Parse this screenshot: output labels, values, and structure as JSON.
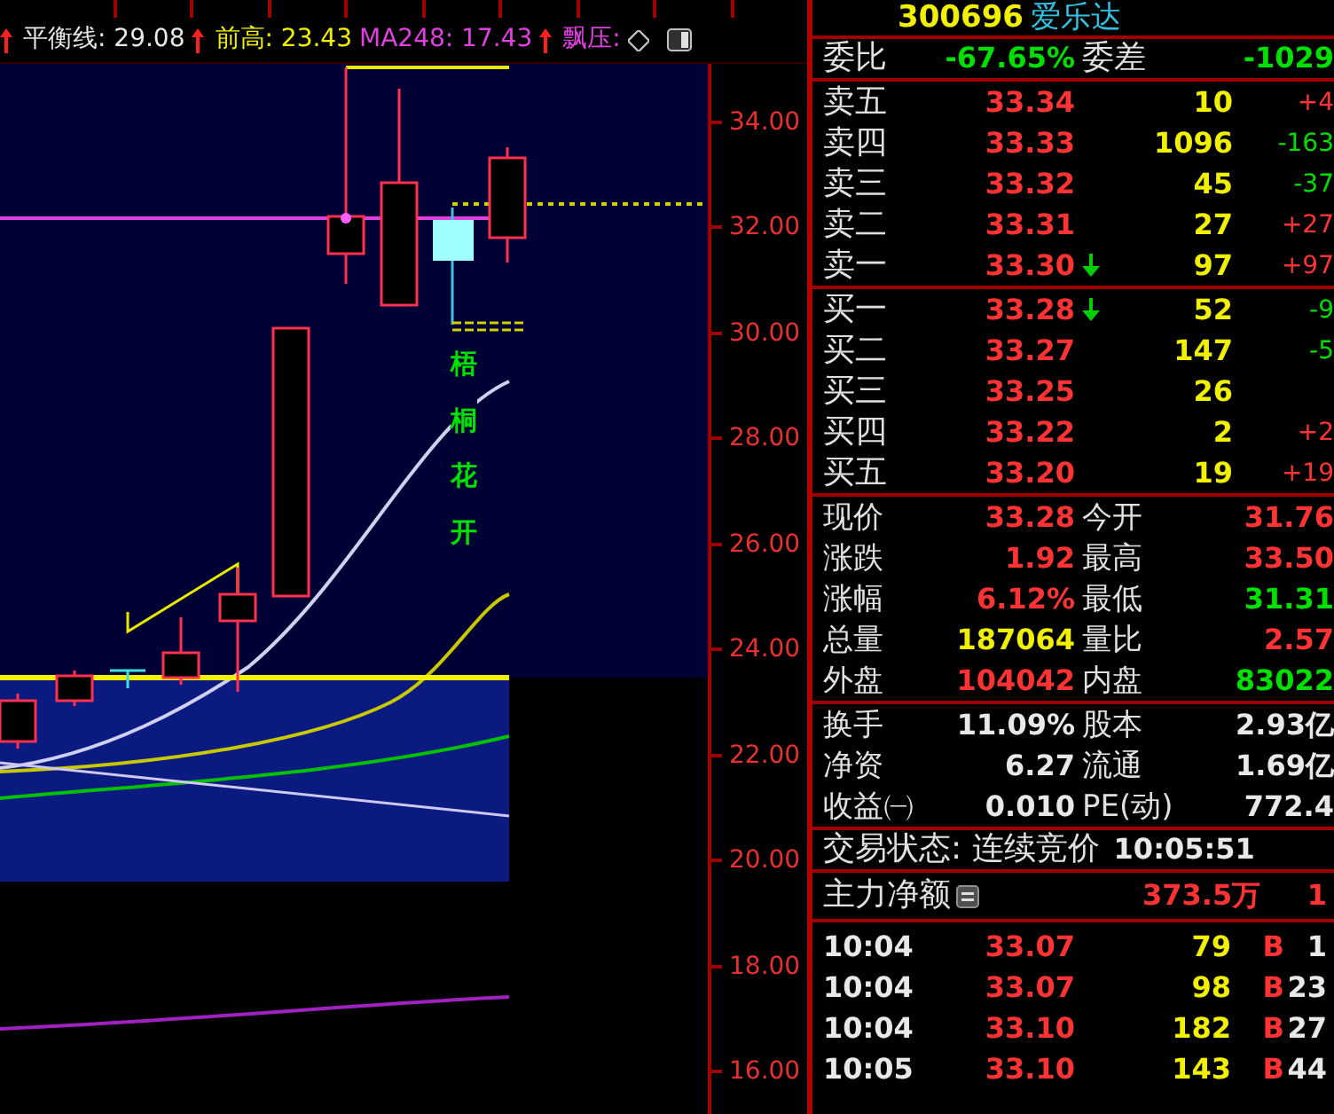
{
  "indicators": [
    {
      "label": "平衡线: 29.08",
      "color": "#e8e8e8",
      "arrow_before": true
    },
    {
      "label": "前高: 23.43",
      "color": "#f0f000",
      "arrow_before": true
    },
    {
      "label": "MA248: 17.43",
      "color": "#e040e0",
      "arrow_before": false
    },
    {
      "label": "飘压:",
      "color": "#e040e0",
      "arrow_before": true
    }
  ],
  "chart": {
    "y_axis": [
      "34.00",
      "32.00",
      "30.00",
      "28.00",
      "26.00",
      "24.00",
      "22.00",
      "20.00",
      "18.00",
      "16.00"
    ],
    "annotation": "梧桐花开"
  },
  "quote": {
    "code": "300696",
    "name": "爱乐达"
  },
  "ratio": [
    {
      "label": "委比",
      "value": "-67.65%",
      "color": "#00e000"
    },
    {
      "label": "委差",
      "value": "-1029",
      "color": "#00e000"
    }
  ],
  "asks": [
    {
      "label": "卖五",
      "price": "33.34",
      "volume": "10",
      "change": "+4",
      "color": "#ff3333",
      "arrow": false
    },
    {
      "label": "卖四",
      "price": "33.33",
      "volume": "1096",
      "change": "-163",
      "color": "#00e000",
      "arrow": false
    },
    {
      "label": "卖三",
      "price": "33.32",
      "volume": "45",
      "change": "-37",
      "color": "#00e000",
      "arrow": false
    },
    {
      "label": "卖二",
      "price": "33.31",
      "volume": "27",
      "change": "+27",
      "color": "#ff3333",
      "arrow": false
    },
    {
      "label": "卖一",
      "price": "33.30",
      "volume": "97",
      "change": "+97",
      "color": "#ff3333",
      "arrow": true
    }
  ],
  "bids": [
    {
      "label": "买一",
      "price": "33.28",
      "volume": "52",
      "change": "-9",
      "color": "#00e000",
      "arrow": true
    },
    {
      "label": "买二",
      "price": "33.27",
      "volume": "147",
      "change": "-5",
      "color": "#00e000",
      "arrow": false
    },
    {
      "label": "买三",
      "price": "33.25",
      "volume": "26",
      "arrow": false
    },
    {
      "label": "买四",
      "price": "33.22",
      "volume": "2",
      "change": "+2",
      "color": "#ff3333",
      "arrow": false
    },
    {
      "label": "买五",
      "price": "33.20",
      "volume": "19",
      "change": "+19",
      "color": "#ff3333",
      "arrow": false
    }
  ],
  "stats": [
    [
      {
        "label": "现价",
        "value": "33.28",
        "color": "#ff3333"
      },
      {
        "label": "今开",
        "value": "31.76",
        "color": "#ff3333"
      }
    ],
    [
      {
        "label": "涨跌",
        "value": "1.92",
        "color": "#ff3333"
      },
      {
        "label": "最高",
        "value": "33.50",
        "color": "#ff3333"
      }
    ],
    [
      {
        "label": "涨幅",
        "value": "6.12%",
        "color": "#ff3333"
      },
      {
        "label": "最低",
        "value": "31.31",
        "color": "#00e000"
      }
    ],
    [
      {
        "label": "总量",
        "value": "187064",
        "color": "#f0f000"
      },
      {
        "label": "量比",
        "value": "2.57",
        "color": "#ff3333"
      }
    ],
    [
      {
        "label": "外盘",
        "value": "104042",
        "color": "#ff3333"
      },
      {
        "label": "内盘",
        "value": "83022",
        "color": "#00e000"
      }
    ]
  ],
  "fundamentals": [
    [
      {
        "label": "换手",
        "value": "11.09%"
      },
      {
        "label": "股本",
        "value": "2.93亿"
      }
    ],
    [
      {
        "label": "净资",
        "value": "6.27"
      },
      {
        "label": "流通",
        "value": "1.69亿"
      }
    ],
    [
      {
        "label": "收益㈠",
        "value": "0.010"
      },
      {
        "label": "PE(动)",
        "value": "772.4"
      }
    ]
  ],
  "status": {
    "label": "交易状态: 连续竞价",
    "time": "10:05:51"
  },
  "main_force": {
    "label": "主力净额",
    "value": "373.5万",
    "extra": "1"
  },
  "ticks": [
    {
      "time": "10:04",
      "price": "33.07",
      "volume": "79",
      "side": "B",
      "extra": "1"
    },
    {
      "time": "10:04",
      "price": "33.07",
      "volume": "98",
      "side": "B",
      "extra": "23"
    },
    {
      "time": "10:04",
      "price": "33.10",
      "volume": "182",
      "side": "B",
      "extra": "27"
    },
    {
      "time": "10:05",
      "price": "33.10",
      "volume": "143",
      "side": "B",
      "extra": "44"
    }
  ]
}
